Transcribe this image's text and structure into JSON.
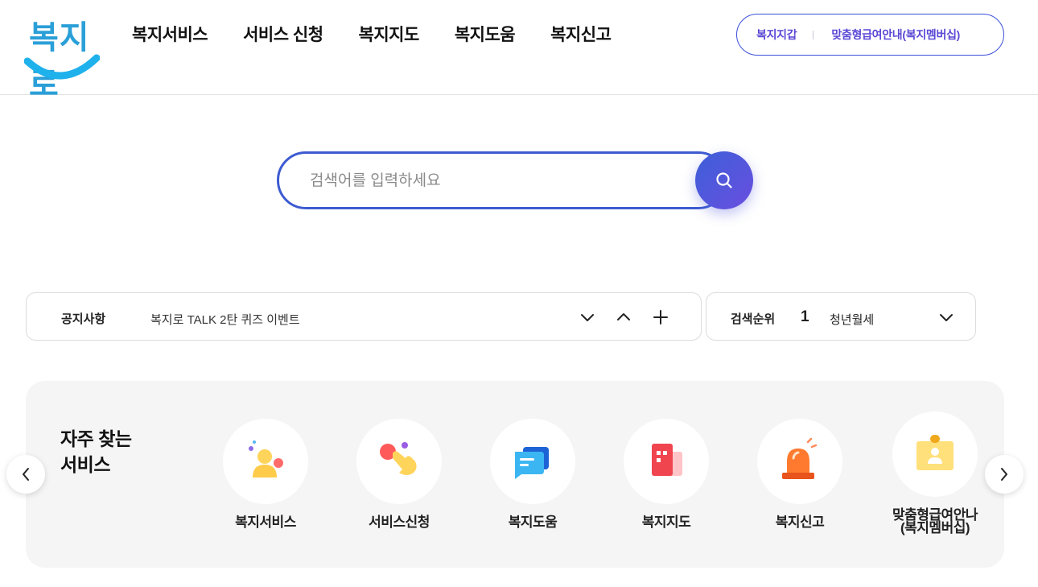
{
  "header": {
    "logo_text": "복지로",
    "nav": [
      "복지서비스",
      "서비스 신청",
      "복지지도",
      "복지도움",
      "복지신고"
    ],
    "util_links": [
      "복지지갑",
      "맞춤형급여안내(복지멤버십)"
    ]
  },
  "search": {
    "placeholder": "검색어를 입력하세요"
  },
  "notice": {
    "label": "공지사항",
    "text": "복지로 TALK 2탄 퀴즈 이벤트"
  },
  "search_rank": {
    "label": "검색순위",
    "rank": "1",
    "term": "청년월세"
  },
  "quick_services": {
    "title_line1": "자주 찾는",
    "title_line2": "서비스",
    "items": [
      {
        "label": "복지서비스",
        "icon": "person-icon"
      },
      {
        "label": "서비스신청",
        "icon": "hand-pointer-icon"
      },
      {
        "label": "복지도움",
        "icon": "chat-bubble-icon"
      },
      {
        "label": "복지지도",
        "icon": "building-icon"
      },
      {
        "label": "복지신고",
        "icon": "siren-icon"
      },
      {
        "label_line1": "맞춤형급여안나",
        "label_line2": "(복지멤버십)",
        "icon": "id-badge-icon"
      }
    ]
  },
  "colors": {
    "brand_blue": "#3d5bd1",
    "brand_purple": "#5a48d6",
    "logo_blue": "#2a9fd8"
  }
}
